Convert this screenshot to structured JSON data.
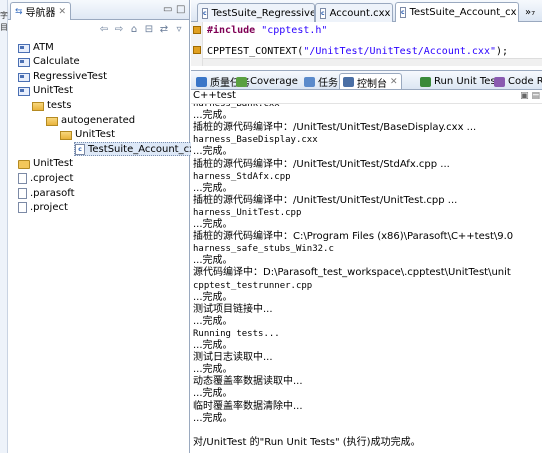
{
  "left_strip": {
    "label_a": "字",
    "label_b": "目"
  },
  "navigator": {
    "title": "导航器",
    "tree": [
      {
        "label": "ATM",
        "icon": "source-folder-icon",
        "depth": 0
      },
      {
        "label": "Calculate",
        "icon": "source-folder-icon",
        "depth": 0
      },
      {
        "label": "RegressiveTest",
        "icon": "source-folder-icon",
        "depth": 0
      },
      {
        "label": "UnitTest",
        "icon": "source-folder-icon",
        "depth": 0
      },
      {
        "label": "tests",
        "icon": "folder-open-icon",
        "depth": 1
      },
      {
        "label": "autogenerated",
        "icon": "folder-open-icon",
        "depth": 2
      },
      {
        "label": "UnitTest",
        "icon": "folder-open-icon",
        "depth": 3
      },
      {
        "label": "TestSuite_Account_cxx",
        "icon": "cpp-file-icon",
        "depth": 4,
        "selected": true
      },
      {
        "label": "UnitTest",
        "icon": "build-folder-icon",
        "depth": 0
      },
      {
        "label": ".cproject",
        "icon": "file-icon",
        "depth": 0
      },
      {
        "label": ".parasoft",
        "icon": "file-icon",
        "depth": 0
      },
      {
        "label": ".project",
        "icon": "file-icon",
        "depth": 0
      }
    ]
  },
  "editor": {
    "tabs": [
      {
        "label": "TestSuite_Regressive",
        "active": false
      },
      {
        "label": "Account.cxx",
        "active": false
      },
      {
        "label": "TestSuite_Account_cx",
        "active": true
      },
      {
        "label": "»₇",
        "active": false
      }
    ],
    "line1_kw": "#include",
    "line1_str": "\"cpptest.h\"",
    "line2_pre": "CPPTEST_CONTEXT(",
    "line2_str": "\"/UnitTest/UnitTest/Account.cxx\"",
    "line2_post": ");"
  },
  "views": {
    "tabs": [
      {
        "label": "质量任务",
        "color": "#3a76c8"
      },
      {
        "label": "Coverage",
        "color": "#5aa040"
      },
      {
        "label": "任务",
        "color": "#5a8acb"
      },
      {
        "label": "控制台",
        "color": "#4a6fa5",
        "active": true
      },
      {
        "label": "Run Unit Tes",
        "color": "#3a8a3a"
      },
      {
        "label": "Code Revi",
        "color": "#8a5ab0"
      }
    ]
  },
  "console": {
    "title": "C++test",
    "lines": [
      {
        "text": "harness_Bank.cxx",
        "mono": true
      },
      {
        "text": "...完成。",
        "mono": false
      },
      {
        "text": "插桩的源代码编译中：/UnitTest/UnitTest/BaseDisplay.cxx ...",
        "mono": false
      },
      {
        "text": "harness_BaseDisplay.cxx",
        "mono": true
      },
      {
        "text": "...完成。",
        "mono": false
      },
      {
        "text": "插桩的源代码编译中：/UnitTest/UnitTest/StdAfx.cpp ...",
        "mono": false
      },
      {
        "text": "harness_StdAfx.cpp",
        "mono": true
      },
      {
        "text": "...完成。",
        "mono": false
      },
      {
        "text": "插桩的源代码编译中：/UnitTest/UnitTest/UnitTest.cpp ...",
        "mono": false
      },
      {
        "text": "harness_UnitTest.cpp",
        "mono": true
      },
      {
        "text": "...完成。",
        "mono": false
      },
      {
        "text": "插桩的源代码编译中：C:\\Program Files (x86)\\Parasoft\\C++test\\9.0",
        "mono": false
      },
      {
        "text": "harness_safe_stubs_Win32.c",
        "mono": true
      },
      {
        "text": "...完成。",
        "mono": false
      },
      {
        "text": "源代码编译中：D:\\Parasoft_test_workspace\\.cpptest\\UnitTest\\unit",
        "mono": false
      },
      {
        "text": "cpptest_testrunner.cpp",
        "mono": true
      },
      {
        "text": "...完成。",
        "mono": false
      },
      {
        "text": "测试项目链接中...",
        "mono": false
      },
      {
        "text": "...完成。",
        "mono": false
      },
      {
        "text": "Running tests...",
        "mono": true
      },
      {
        "text": "...完成。",
        "mono": false
      },
      {
        "text": "测试日志读取中...",
        "mono": false
      },
      {
        "text": "...完成。",
        "mono": false
      },
      {
        "text": "动态覆盖率数据读取中...",
        "mono": false
      },
      {
        "text": "...完成。",
        "mono": false
      },
      {
        "text": "临时覆盖率数据清除中...",
        "mono": false
      },
      {
        "text": "...完成。",
        "mono": false
      },
      {
        "text": "",
        "mono": false
      },
      {
        "text": "对/UnitTest 的\"Run Unit Tests\" (执行)成功完成。",
        "mono": false
      }
    ]
  }
}
